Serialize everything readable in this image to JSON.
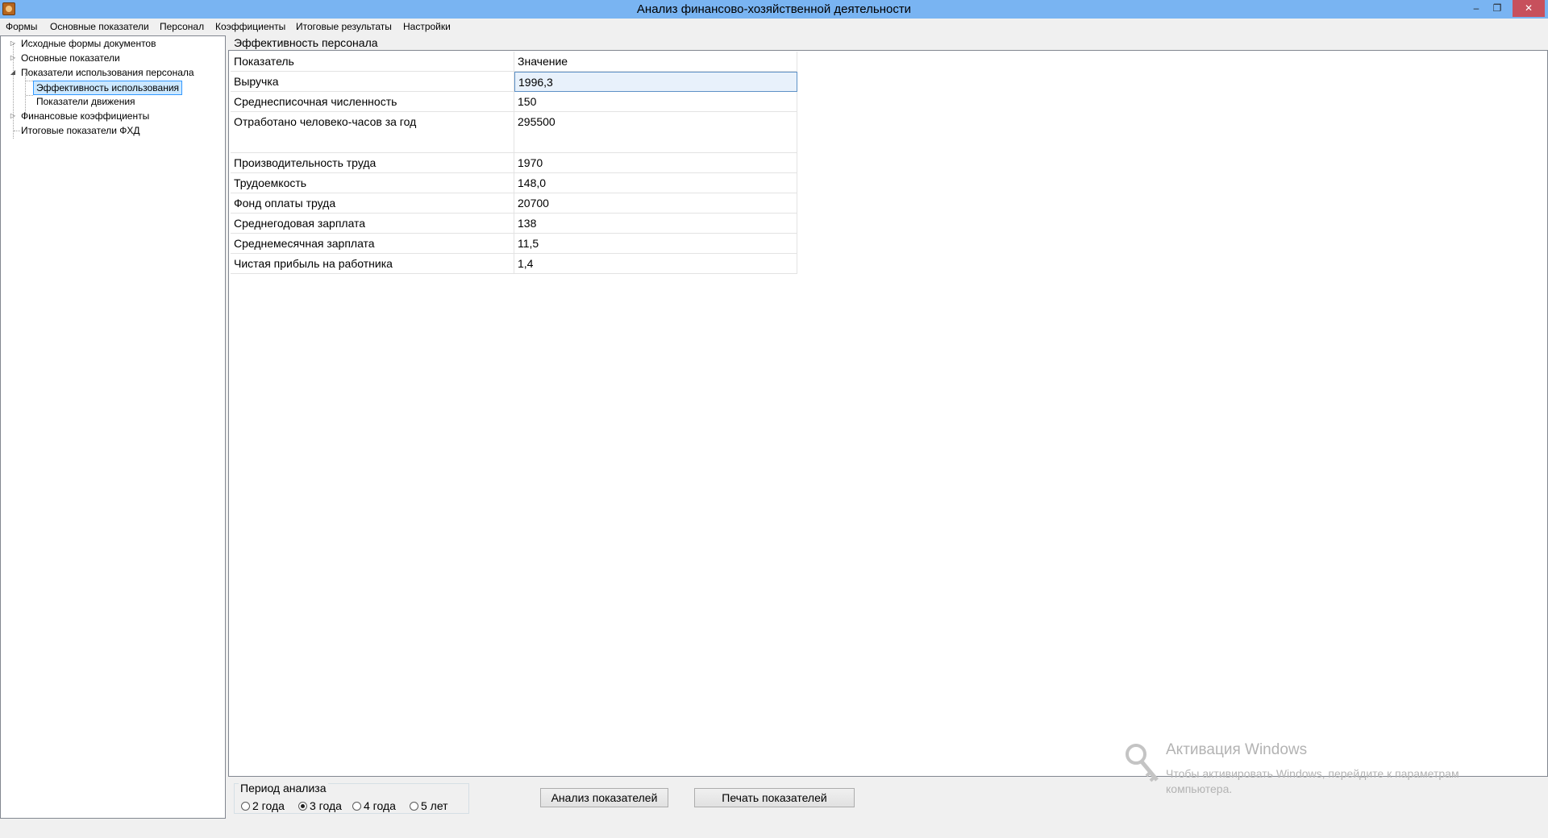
{
  "window": {
    "title": "Анализ финансово-хозяйственной деятельности",
    "minimize": "–",
    "restore": "❐",
    "close": "✕"
  },
  "menu": [
    "Формы",
    "Основные показатели",
    "Персонал",
    "Коэффициенты",
    "Итоговые результаты",
    "Настройки"
  ],
  "tree": {
    "items": [
      {
        "label": "Исходные формы документов",
        "state": "collapsed"
      },
      {
        "label": "Основные показатели",
        "state": "collapsed"
      },
      {
        "label": "Показатели  использования персонала",
        "state": "expanded"
      },
      {
        "label": "Эффективность использования",
        "state": "selected"
      },
      {
        "label": "Показатели движения",
        "state": "leaf"
      },
      {
        "label": "Финансовые коэффициенты",
        "state": "collapsed"
      },
      {
        "label": "Итоговые показатели ФХД",
        "state": "leaf"
      }
    ]
  },
  "panel": {
    "title": "Эффективность персонала"
  },
  "grid": {
    "headers": [
      "Показатель",
      "Значение"
    ],
    "rows": [
      [
        "Выручка",
        "1996,3"
      ],
      [
        "Среднесписочная численность",
        "150"
      ],
      [
        "Отработано человеко-часов за год",
        "295500"
      ],
      [
        "Производительность труда",
        "1970"
      ],
      [
        "Трудоемкость",
        "148,0"
      ],
      [
        "Фонд оплаты труда",
        "20700"
      ],
      [
        "Среднегодовая зарплата",
        "138"
      ],
      [
        "Среднемесячная зарплата",
        "11,5"
      ],
      [
        "Чистая прибыль на работника",
        "1,4"
      ]
    ]
  },
  "period": {
    "label": "Период анализа",
    "options": [
      "2 года",
      "3 года",
      "4 года",
      "5 лет"
    ],
    "selected": "3 года"
  },
  "buttons": {
    "analyze": "Анализ показателей",
    "print": "Печать показателей"
  },
  "activation": {
    "title": "Активация Windows",
    "line1": "Чтобы активировать Windows, перейдите к параметрам",
    "line2": "компьютера."
  }
}
